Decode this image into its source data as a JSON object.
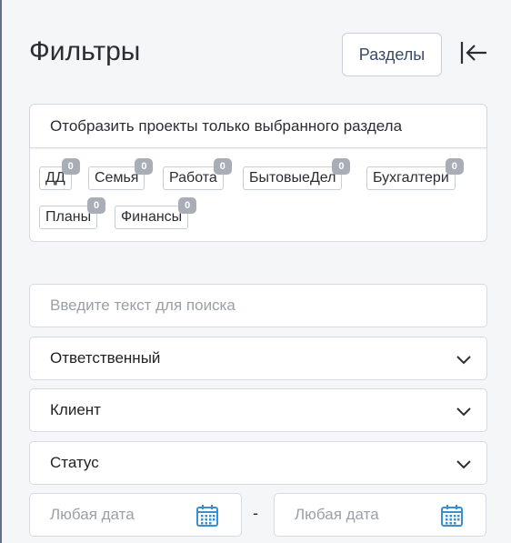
{
  "header": {
    "title": "Фильтры",
    "sections_button": "Разделы",
    "collapse_icon": "collapse-left-icon"
  },
  "sections": {
    "only_selected_label": "Отобразить проекты только выбранного раздела",
    "tags": [
      {
        "label": "ДД",
        "count": "0"
      },
      {
        "label": "Семья",
        "count": "0"
      },
      {
        "label": "Работа",
        "count": "0"
      },
      {
        "label": "БытовыеДел",
        "count": "0"
      },
      {
        "label": "Бухгалтери",
        "count": "0"
      },
      {
        "label": "Планы",
        "count": "0"
      },
      {
        "label": "Финансы",
        "count": "0"
      }
    ]
  },
  "filters": {
    "search_placeholder": "Введите текст для поиска",
    "responsible": "Ответственный",
    "client": "Клиент",
    "status": "Статус",
    "date_from_placeholder": "Любая дата",
    "date_separator": "-",
    "date_to_placeholder": "Любая дата"
  },
  "colors": {
    "accent": "#3a8fd1",
    "badge": "#a9aeb6",
    "border": "#d7dbe1"
  }
}
